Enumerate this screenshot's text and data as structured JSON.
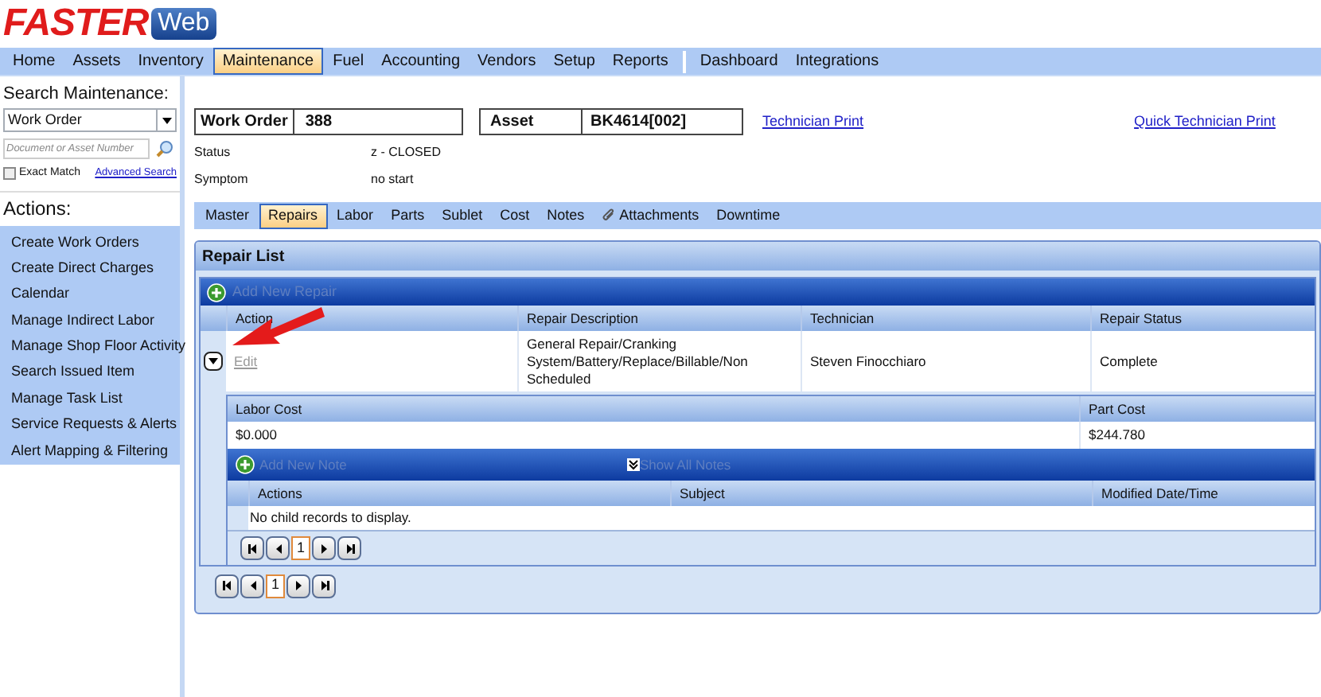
{
  "logo": {
    "brand": "FASTER",
    "product": "Web"
  },
  "nav": [
    {
      "label": "Home",
      "selected": false
    },
    {
      "label": "Assets",
      "selected": false
    },
    {
      "label": "Inventory",
      "selected": false
    },
    {
      "label": "Maintenance",
      "selected": true
    },
    {
      "label": "Fuel",
      "selected": false
    },
    {
      "label": "Accounting",
      "selected": false
    },
    {
      "label": "Vendors",
      "selected": false
    },
    {
      "label": "Setup",
      "selected": false
    },
    {
      "label": "Reports",
      "selected": false
    },
    {
      "label": "Dashboard",
      "selected": false
    },
    {
      "label": "Integrations",
      "selected": false
    }
  ],
  "sidebar": {
    "search_title": "Search Maintenance:",
    "search_type": "Work Order",
    "search_field": {
      "placeholder": "Document or Asset Number"
    },
    "exact_match": {
      "label": "Exact Match",
      "checked": false
    },
    "advanced_search": "Advanced Search",
    "actions_title": "Actions:",
    "actions": [
      "Create Work Orders",
      "Create Direct Charges",
      "Calendar",
      "Manage Indirect Labor",
      "Manage Shop Floor Activity",
      "Search Issued Item",
      "Manage Task List",
      "Service Requests & Alerts",
      "Alert Mapping & Filtering"
    ]
  },
  "header": {
    "work_order_label": "Work Order",
    "work_order": "388",
    "asset_label": "Asset",
    "asset": "BK4614[002]",
    "links": [
      "Technician Print",
      "Quick Technician Print"
    ],
    "fields": [
      {
        "label": "Status",
        "value": "z - CLOSED"
      },
      {
        "label": "Symptom",
        "value": "no start"
      }
    ]
  },
  "tabs": [
    {
      "label": "Master",
      "selected": false
    },
    {
      "label": "Repairs",
      "selected": true
    },
    {
      "label": "Labor",
      "selected": false
    },
    {
      "label": "Parts",
      "selected": false
    },
    {
      "label": "Sublet",
      "selected": false
    },
    {
      "label": "Cost",
      "selected": false
    },
    {
      "label": "Notes",
      "selected": false
    },
    {
      "label": "Attachments",
      "selected": false
    },
    {
      "label": "Downtime",
      "selected": false
    }
  ],
  "repair_list": {
    "title": "Repair List",
    "add_button": {
      "label": "Add New Repair",
      "disabled": true
    },
    "columns": [
      "Action",
      "Repair Description",
      "Technician",
      "Repair Status"
    ],
    "rows": [
      {
        "expanded": true,
        "action": "Edit",
        "description": "General Repair/Cranking System/Battery/Replace/Billable/Non Scheduled",
        "technician": "Steven Finocchiaro",
        "status": "Complete",
        "detail": {
          "columns": [
            "Labor Cost",
            "Part Cost"
          ],
          "values": [
            "$0.000",
            "$244.780"
          ],
          "add_note": {
            "label": "Add New Note",
            "disabled": true
          },
          "show_all_notes": {
            "label": "Show All Notes",
            "disabled": true
          },
          "note_columns": [
            "Actions",
            "Subject",
            "Modified Date/Time"
          ],
          "empty_message": "No child records to display.",
          "page": "1"
        }
      }
    ],
    "page": "1"
  }
}
